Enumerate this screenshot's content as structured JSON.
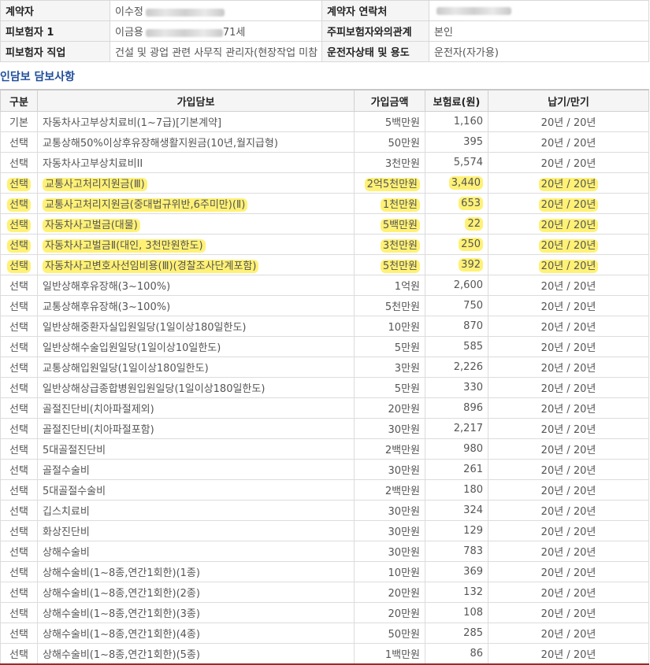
{
  "contract_info": {
    "rows": [
      {
        "label1": "계약자",
        "value1": "이수정",
        "label2": "계약자 연락처",
        "value2": ""
      },
      {
        "label1": "피보험자 1",
        "value1": "이금용",
        "value1_suffix": "71세",
        "label2": "주피보험자와의관계",
        "value2": "본인"
      },
      {
        "label1": "피보험자 직업",
        "value1": "건설 및 광업 관련 사무직 관리자(현장작업 미참",
        "label2": "운전자상태 및 용도",
        "value2": "운전자(자가용)"
      }
    ]
  },
  "section_title": "인담보 담보사항",
  "table": {
    "headers": [
      "구분",
      "가입담보",
      "가입금액",
      "보험료(원)",
      "납기/만기"
    ],
    "rows": [
      {
        "type": "기본",
        "coverage": "자동차사고부상치료비(1~7급)[기본계약]",
        "amount": "5백만원",
        "premium": "1,160",
        "term": "20년 / 20년",
        "highlight": false
      },
      {
        "type": "선택",
        "coverage": "교통상해50%이상후유장해생활지원금(10년,월지급형)",
        "amount": "50만원",
        "premium": "395",
        "term": "20년 / 20년",
        "highlight": false
      },
      {
        "type": "선택",
        "coverage": "자동차사고부상치료비II",
        "amount": "3천만원",
        "premium": "5,574",
        "term": "20년 / 20년",
        "highlight": false
      },
      {
        "type": "선택",
        "coverage": "교통사고처리지원금(Ⅲ)",
        "amount": "2억5천만원",
        "premium": "3,440",
        "term": "20년 / 20년",
        "highlight": true
      },
      {
        "type": "선택",
        "coverage": "교통사고처리지원금(중대법규위반,6주미만)(Ⅱ)",
        "amount": "1천만원",
        "premium": "653",
        "term": "20년 / 20년",
        "highlight": true
      },
      {
        "type": "선택",
        "coverage": "자동차사고벌금(대물)",
        "amount": "5백만원",
        "premium": "22",
        "term": "20년 / 20년",
        "highlight": true
      },
      {
        "type": "선택",
        "coverage": "자동차사고벌금Ⅱ(대인, 3천만원한도)",
        "amount": "3천만원",
        "premium": "250",
        "term": "20년 / 20년",
        "highlight": true
      },
      {
        "type": "선택",
        "coverage": "자동차사고변호사선임비용(Ⅲ)(경찰조사단계포함)",
        "amount": "5천만원",
        "premium": "392",
        "term": "20년 / 20년",
        "highlight": true
      },
      {
        "type": "선택",
        "coverage": "일반상해후유장해(3~100%)",
        "amount": "1억원",
        "premium": "2,600",
        "term": "20년 / 20년",
        "highlight": false
      },
      {
        "type": "선택",
        "coverage": "교통상해후유장해(3~100%)",
        "amount": "5천만원",
        "premium": "750",
        "term": "20년 / 20년",
        "highlight": false
      },
      {
        "type": "선택",
        "coverage": "일반상해중환자실입원일당(1일이상180일한도)",
        "amount": "10만원",
        "premium": "870",
        "term": "20년 / 20년",
        "highlight": false
      },
      {
        "type": "선택",
        "coverage": "일반상해수술입원일당(1일이상10일한도)",
        "amount": "5만원",
        "premium": "585",
        "term": "20년 / 20년",
        "highlight": false
      },
      {
        "type": "선택",
        "coverage": "교통상해입원일당(1일이상180일한도)",
        "amount": "3만원",
        "premium": "2,226",
        "term": "20년 / 20년",
        "highlight": false
      },
      {
        "type": "선택",
        "coverage": "일반상해상급종합병원입원일당(1일이상180일한도)",
        "amount": "5만원",
        "premium": "330",
        "term": "20년 / 20년",
        "highlight": false
      },
      {
        "type": "선택",
        "coverage": "골절진단비(치아파절제외)",
        "amount": "20만원",
        "premium": "896",
        "term": "20년 / 20년",
        "highlight": false
      },
      {
        "type": "선택",
        "coverage": "골절진단비(치아파절포함)",
        "amount": "30만원",
        "premium": "2,217",
        "term": "20년 / 20년",
        "highlight": false
      },
      {
        "type": "선택",
        "coverage": "5대골절진단비",
        "amount": "2백만원",
        "premium": "980",
        "term": "20년 / 20년",
        "highlight": false
      },
      {
        "type": "선택",
        "coverage": "골절수술비",
        "amount": "30만원",
        "premium": "261",
        "term": "20년 / 20년",
        "highlight": false
      },
      {
        "type": "선택",
        "coverage": "5대골절수술비",
        "amount": "2백만원",
        "premium": "180",
        "term": "20년 / 20년",
        "highlight": false
      },
      {
        "type": "선택",
        "coverage": "깁스치료비",
        "amount": "30만원",
        "premium": "324",
        "term": "20년 / 20년",
        "highlight": false
      },
      {
        "type": "선택",
        "coverage": "화상진단비",
        "amount": "30만원",
        "premium": "129",
        "term": "20년 / 20년",
        "highlight": false
      },
      {
        "type": "선택",
        "coverage": "상해수술비",
        "amount": "30만원",
        "premium": "783",
        "term": "20년 / 20년",
        "highlight": false
      },
      {
        "type": "선택",
        "coverage": "상해수술비(1~8종,연간1회한)(1종)",
        "amount": "10만원",
        "premium": "369",
        "term": "20년 / 20년",
        "highlight": false
      },
      {
        "type": "선택",
        "coverage": "상해수술비(1~8종,연간1회한)(2종)",
        "amount": "20만원",
        "premium": "132",
        "term": "20년 / 20년",
        "highlight": false
      },
      {
        "type": "선택",
        "coverage": "상해수술비(1~8종,연간1회한)(3종)",
        "amount": "20만원",
        "premium": "108",
        "term": "20년 / 20년",
        "highlight": false
      },
      {
        "type": "선택",
        "coverage": "상해수술비(1~8종,연간1회한)(4종)",
        "amount": "50만원",
        "premium": "285",
        "term": "20년 / 20년",
        "highlight": false
      },
      {
        "type": "선택",
        "coverage": "상해수술비(1~8종,연간1회한)(5종)",
        "amount": "1백만원",
        "premium": "86",
        "term": "20년 / 20년",
        "highlight": false
      }
    ]
  },
  "colors": {
    "highlight": "#fff176",
    "section_title": "#1f4e9a",
    "bottom_rule": "#9a2a2a"
  }
}
